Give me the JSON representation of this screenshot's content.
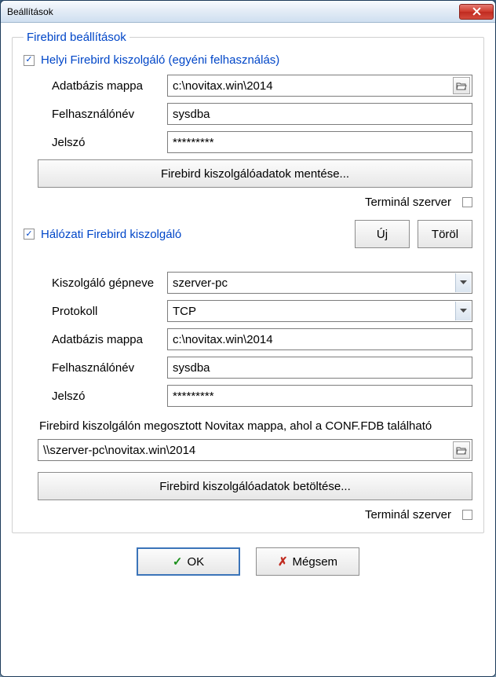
{
  "window": {
    "title": "Beállítások"
  },
  "group": {
    "legend": "Firebird beállítások"
  },
  "local": {
    "heading": "Helyi Firebird kiszolgáló (egyéni felhasználás)",
    "checked": true,
    "db_folder_label": "Adatbázis mappa",
    "db_folder_value": "c:\\novitax.win\\2014",
    "user_label": "Felhasználónév",
    "user_value": "sysdba",
    "pass_label": "Jelszó",
    "pass_value": "*********",
    "save_button": "Firebird kiszolgálóadatok mentése...",
    "terminal_label": "Terminál szerver"
  },
  "network": {
    "heading": "Hálózati Firebird kiszolgáló",
    "checked": true,
    "new_button": "Új",
    "delete_button": "Töröl",
    "host_label": "Kiszolgáló gépneve",
    "host_value": "szerver-pc",
    "protocol_label": "Protokoll",
    "protocol_value": "TCP",
    "db_folder_label": "Adatbázis mappa",
    "db_folder_value": "c:\\novitax.win\\2014",
    "user_label": "Felhasználónév",
    "user_value": "sysdba",
    "pass_label": "Jelszó",
    "pass_value": "*********",
    "shared_label": "Firebird kiszolgálón megosztott Novitax mappa, ahol a CONF.FDB található",
    "shared_value": "\\\\szerver-pc\\novitax.win\\2014",
    "load_button": "Firebird kiszolgálóadatok betöltése...",
    "terminal_label": "Terminál szerver"
  },
  "buttons": {
    "ok": "OK",
    "cancel": "Mégsem"
  }
}
